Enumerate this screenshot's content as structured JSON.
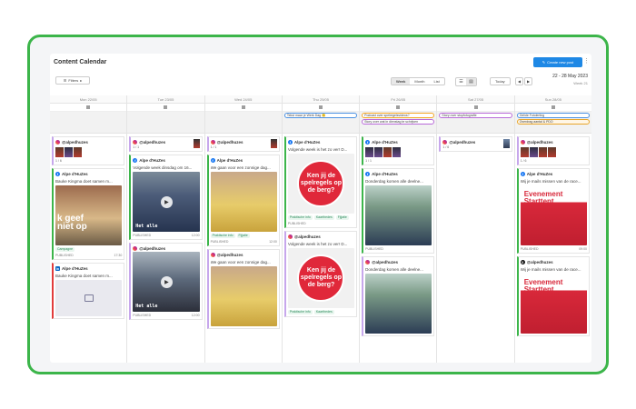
{
  "header": {
    "title": "Content Calendar",
    "new_post_label": "Create new post",
    "filters_label": "Filters",
    "views": [
      "Week",
      "Month",
      "List"
    ],
    "active_view": "Week",
    "today_label": "Today",
    "date_range": "22 - 28 May 2023",
    "week_label": "Week 21"
  },
  "days": [
    {
      "label": "Mon 22/05"
    },
    {
      "label": "Tue 23/05"
    },
    {
      "label": "Wed 24/05"
    },
    {
      "label": "Thu 25/05"
    },
    {
      "label": "Fri 26/05"
    },
    {
      "label": "Sat 27/05"
    },
    {
      "label": "Sun 28/05"
    }
  ],
  "notes": {
    "thu": [
      "Tekst maar je Werk Dag 🙂"
    ],
    "fri": [
      "Podcast over spelregelsvideos?",
      "Story over wat in dienstag te schrijven"
    ],
    "sat": [
      "Story over stopfotografie"
    ],
    "sun": [
      "Gelide Fotolerling",
      "Overdrag aantal & PDO"
    ]
  },
  "cards": {
    "mon_1": {
      "account": "@alpedhuzes",
      "count": "1 / 6"
    },
    "mon_2": {
      "account": "Alpe d'HuZes",
      "text": "Bauke Kingma doet samen m...",
      "overlay": "k geef\nniet op",
      "tag": "Campagne",
      "status": "PUBLISHED",
      "time": "17:30"
    },
    "mon_3": {
      "account": "Alpe d'HuZes",
      "text": "Bauke Kingma doet samen m..."
    },
    "tue_1": {
      "account": "@alpedhuzes",
      "count": "1 / 1"
    },
    "tue_2": {
      "account": "Alpe d'HuZes",
      "text": "Volgende week dinsdag om 16...",
      "overlay": "Het alle",
      "status": "PUBLISHED",
      "time": "12:00"
    },
    "tue_3": {
      "account": "@alpedhuzes",
      "overlay": "Het alle",
      "status": "PUBLISHED",
      "time": "12:00"
    },
    "wed_1": {
      "account": "@alpedhuzes",
      "count": "1 / 1"
    },
    "wed_2": {
      "account": "Alpe d'HuZes",
      "text": "We gaan voor een zonnige dag...",
      "tags": [
        "Praktische info",
        "Fijjatie"
      ],
      "status": "PUBLISHED",
      "time": "12:00"
    },
    "wed_3": {
      "account": "@alpedhuzes",
      "text": "We gaan voor een zonnige dag..."
    },
    "thu_1": {
      "account": "Alpe d'HuZes",
      "text": "Volgende week is het zo ver! D...",
      "circle": "Ken jij de spelregels op de berg?",
      "tags": [
        "Praktische info",
        "Kaarthedes",
        "Fijjatie"
      ],
      "status": "PUBLISHED"
    },
    "thu_2": {
      "account": "@alpedhuzes",
      "text": "Volgende week is het zo ver! D...",
      "circle": "Ken jij de spelregels op de berg?",
      "tags": [
        "Praktische info",
        "Kaarthedes"
      ]
    },
    "fri_1": {
      "account": "Alpe d'HuZes",
      "count": "1 / 1"
    },
    "fri_2": {
      "account": "Alpe d'HuZes",
      "text": "Donderdag komen alle deelne...",
      "status": "PUBLISHED"
    },
    "fri_3": {
      "account": "@alpedhuzes",
      "text": "Donderdag komen alle deelne..."
    },
    "sat_1": {
      "account": "@alpedhuzes",
      "count": "1 / 6"
    },
    "sun_1": {
      "account": "@alpedhuzes",
      "count": "1 / 6"
    },
    "sun_2": {
      "account": "Alpe d'HuZes",
      "text": "Wij je mails missen van de race...",
      "event_title": "Evenement\nStarttent",
      "status": "PUBLISHED",
      "time": "09:00"
    },
    "sun_3": {
      "account": "@alpedhuzes",
      "text": "Wij je mails missen van de race...",
      "event_title": "Evenement\nStarttent"
    }
  }
}
